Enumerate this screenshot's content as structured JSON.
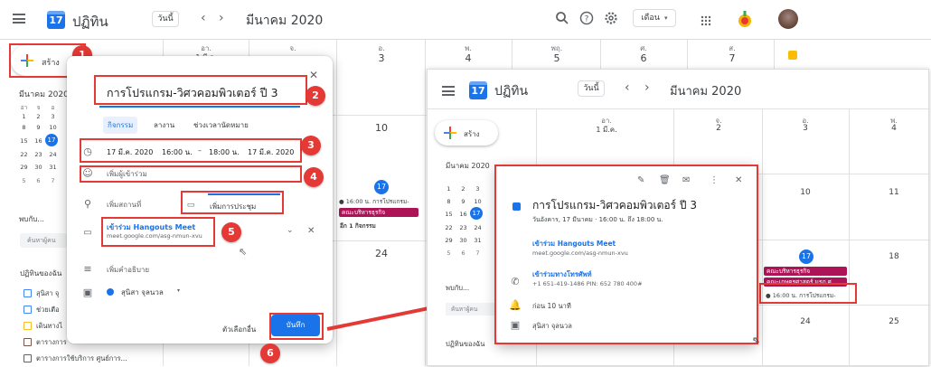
{
  "header": {
    "app_name": "ปฏิทิน",
    "logo_day": "17",
    "today_btn": "วันนี้",
    "month_title": "มีนาคม 2020",
    "view_select": "เดือน",
    "colors": {
      "brand_blue": "#1a73e8",
      "red_annotation": "#e53935"
    }
  },
  "create_button": "สร้าง",
  "grid": {
    "day_heads": [
      "อา.",
      "จ.",
      "อ.",
      "พ.",
      "พฤ.",
      "ศ.",
      "ส."
    ],
    "row1_nums": [
      "1 มี.ค.",
      "2",
      "3",
      "4",
      "5",
      "6",
      "7"
    ],
    "row2_num_10": "10",
    "row3_num_24": "24",
    "left_event_time": "● 16:00 น. การโปรแกรม-",
    "left_event_chip": "คณะบริหารธุรกิจ",
    "left_more": "อีก 1 กิจกรรม",
    "left_today": "17"
  },
  "sidebar": {
    "month": "มีนาคม 2020",
    "weekday_letters": [
      "อา",
      "จ",
      "อ",
      "พ",
      "พฤ",
      "ศ",
      "ส"
    ],
    "weeks": [
      [
        "1",
        "2",
        "3"
      ],
      [
        "8",
        "9",
        "10"
      ],
      [
        "15",
        "16",
        "17"
      ],
      [
        "22",
        "23",
        "24"
      ],
      [
        "29",
        "30",
        "31"
      ],
      [
        "5",
        "6",
        "7"
      ]
    ],
    "meet_with": "พบกับ...",
    "search_people": "ค้นหาผู้คน",
    "my_calendars": "ปฏิทินของฉัน",
    "calendars": [
      "สุนิสา จุ",
      "ช่วยเตือ",
      "เดินทางไ",
      "ตารางการ",
      "ตารางการใช้บริการ ศูนย์การ..."
    ]
  },
  "dialog": {
    "title": "การโปรแกรม-วิศวคอมพิวเตอร์ ปี 3",
    "tabs": [
      "กิจกรรม",
      "ลางาน",
      "ช่วงเวลานัดหมาย"
    ],
    "date_start": "17 มี.ค. 2020",
    "time_start": "16:00 น.",
    "dash": "–",
    "time_end": "18:00 น.",
    "date_end": "17 มี.ค. 2020",
    "add_guests": "เพิ่มผู้เข้าร่วม",
    "add_location": "เพิ่มสถานที่",
    "add_meeting": "เพิ่มการประชุม",
    "hangouts": "เข้าร่วม Hangouts Meet",
    "meet_link": "meet.google.com/asg-nmun-xvu",
    "add_desc": "เพิ่มคำอธิบาย",
    "calendar_owner": "สุนิสา จุลนวล",
    "more_options": "ตัวเลือกอื่น",
    "save": "บันทึก"
  },
  "badges": [
    "1",
    "2",
    "3",
    "4",
    "5",
    "6"
  ],
  "right": {
    "app_name": "ปฏิทิน",
    "logo_day": "17",
    "today_btn": "วันนี้",
    "month_title": "มีนาคม 2020",
    "create_button": "สร้าง",
    "sidebar_month": "มีนาคม 2020",
    "day_heads": [
      "อา.",
      "จ.",
      "อ.",
      "พ."
    ],
    "row1_nums": [
      "1 มี.ค.",
      "2",
      "3",
      "4"
    ],
    "weeks": [
      [
        "1",
        "2",
        "3"
      ],
      [
        "8",
        "9",
        "10"
      ],
      [
        "15",
        "16",
        "17"
      ],
      [
        "22",
        "23",
        "24"
      ],
      [
        "29",
        "30",
        "31"
      ],
      [
        "5",
        "6",
        "7"
      ]
    ],
    "num_10": "10",
    "num_11": "11",
    "num_17": "17",
    "num_18": "18",
    "num_24": "24",
    "num_25": "25",
    "meet_with": "พบกับ...",
    "search_people": "ค้นหาผู้คน",
    "my_calendars": "ปฏิทินของฉัน",
    "chip_biz": "คณะบริหารธุรกิจ",
    "chip_eng": "คณะเกษตรศาสตร์ มรภ.ศ",
    "chip_event": "● 16:00 น. การโปรแกรม-"
  },
  "popup": {
    "title": "การโปรแกรม-วิศวคอมพิวเตอร์ ปี 3",
    "datetime": "วันอังคาร, 17 มีนาคม  ·  16:00 น. ถึง 18:00 น.",
    "hangouts": "เข้าร่วม Hangouts Meet",
    "meet_link": "meet.google.com/asg-nmun-xvu",
    "phone_label": "เข้าร่วมทางโทรศัพท์",
    "phone_number": "+1 651-419-1486 PIN: 652 780 400#",
    "reminder": "ก่อน 10 นาที",
    "owner": "สุนิสา จุลนวล"
  }
}
